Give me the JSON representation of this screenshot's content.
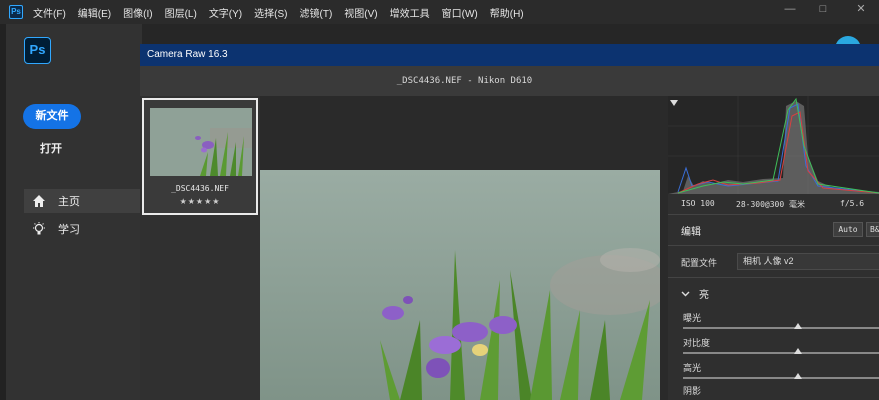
{
  "menubar": {
    "logo": "Ps",
    "items": [
      "文件(F)",
      "编辑(E)",
      "图像(I)",
      "图层(L)",
      "文字(Y)",
      "选择(S)",
      "滤镜(T)",
      "视图(V)",
      "增效工具",
      "窗口(W)",
      "帮助(H)"
    ]
  },
  "window_controls": {
    "minimize": "—",
    "maximize": "□",
    "close": "✕"
  },
  "home": {
    "logo": "Ps",
    "new_file": "新文件",
    "open": "打开",
    "nav": [
      {
        "label": "主页",
        "icon": "home-icon",
        "active": true
      },
      {
        "label": "学习",
        "icon": "lightbulb-icon",
        "active": false
      }
    ]
  },
  "camera_raw": {
    "title": "Camera Raw 16.3",
    "file_info": "_DSC4436.NEF  -  Nikon D610",
    "thumbnail": {
      "name": "_DSC4436.NEF",
      "stars": "★★★★★"
    },
    "camera_info": {
      "iso": "ISO 100",
      "lens": "28-300@300 毫米",
      "aperture": "f/5.6"
    },
    "edit": {
      "label": "编辑",
      "auto": "Auto",
      "bw": "B&W",
      "profile_label": "配置文件",
      "profile_value": "相机 人像 v2",
      "section": "亮",
      "sliders": [
        {
          "label": "曝光",
          "value": 0.5
        },
        {
          "label": "对比度",
          "value": 0.5
        },
        {
          "label": "高光",
          "value": 0.5
        },
        {
          "label": "阴影",
          "value": 0.5
        }
      ]
    }
  },
  "colors": {
    "accent": "#1473e6",
    "title_bar": "#0c3370",
    "ps_blue": "#31a8ff"
  }
}
